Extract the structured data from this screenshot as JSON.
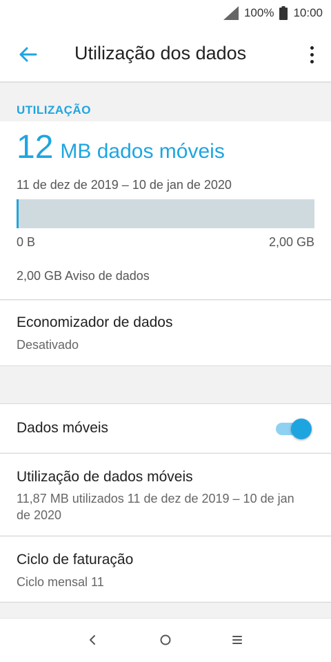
{
  "status_bar": {
    "battery": "100%",
    "time": "10:00"
  },
  "app_bar": {
    "title": "Utilização dos dados"
  },
  "usage": {
    "section_header": "UTILIZAÇÃO",
    "amount": "12",
    "amount_label": "MB dados móveis",
    "date_range": "11 de dez de 2019 – 10 de jan de 2020",
    "bar_min_label": "0 B",
    "bar_max_label": "2,00 GB",
    "fill_fraction": 0.006,
    "warning": "2,00 GB Aviso de dados"
  },
  "data_saver": {
    "title": "Economizador de dados",
    "status": "Desativado"
  },
  "mobile_data": {
    "title": "Dados móveis",
    "enabled": true
  },
  "mobile_usage": {
    "title": "Utilização de dados móveis",
    "detail": "11,87 MB utilizados 11 de dez de 2019 – 10 de jan de 2020"
  },
  "billing": {
    "title": "Ciclo de faturação",
    "detail": "Ciclo mensal 11"
  },
  "colors": {
    "accent": "#1ea5e0",
    "track": "#cfdadf",
    "background": "#f2f2f2"
  },
  "icons": {
    "signal": "signal-icon",
    "battery": "battery-icon",
    "back": "arrow-back-icon",
    "more": "more-vert-icon",
    "nav_back": "nav-back-icon",
    "nav_home": "nav-home-icon",
    "nav_menu": "nav-menu-icon"
  }
}
